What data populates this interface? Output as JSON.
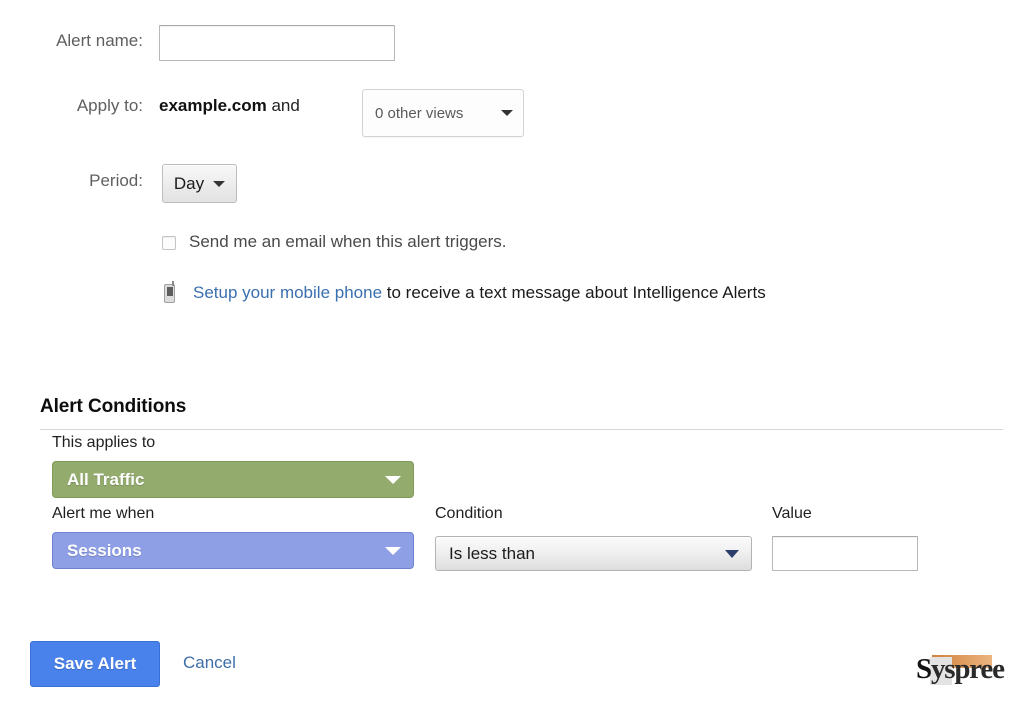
{
  "form": {
    "alert_name": {
      "label": "Alert name:",
      "value": "",
      "placeholder": ""
    },
    "apply_to": {
      "label": "Apply to:",
      "site": "example.com",
      "conjunction": "and",
      "views_dropdown": "0 other views"
    },
    "period": {
      "label": "Period:",
      "value": "Day"
    },
    "email_notify": {
      "text": "Send me an email when this alert triggers.",
      "checked": false
    },
    "sms_notify": {
      "icon": "mobile-phone-icon",
      "link_text": "Setup your mobile phone",
      "rest_text": " to receive a text message about Intelligence Alerts"
    }
  },
  "alert_conditions": {
    "title": "Alert Conditions",
    "applies_to": {
      "label": "This applies to",
      "value": "All Traffic",
      "color": "#93ab6d"
    },
    "alert_me_when": {
      "label": "Alert me when",
      "value": "Sessions",
      "color": "#8e9fe6"
    },
    "condition": {
      "label": "Condition",
      "value": "Is less than"
    },
    "value": {
      "label": "Value",
      "value": "",
      "placeholder": ""
    }
  },
  "footer": {
    "save_label": "Save Alert",
    "cancel_label": "Cancel",
    "save_color": "#4a82ec"
  },
  "logo": {
    "text_a": "S",
    "text_b": "yspree",
    "full": "Syspree"
  }
}
